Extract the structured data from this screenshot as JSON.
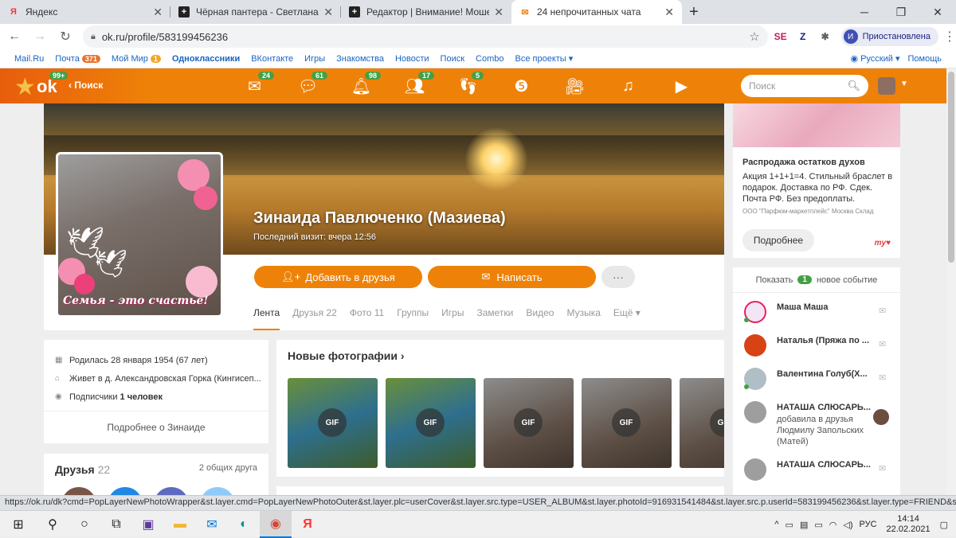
{
  "browser": {
    "tabs": [
      {
        "title": "Яндекс",
        "icon": "yandex-icon"
      },
      {
        "title": "Чёрная пантера - Светлана Хор",
        "icon": "bookmark-icon"
      },
      {
        "title": "Редактор | Внимание! Мошенн",
        "icon": "bookmark-icon"
      },
      {
        "title": "24 непрочитанных чата",
        "icon": "mail-icon"
      }
    ],
    "url": "ok.ru/profile/583199456236",
    "profile_label": "Приостановлена",
    "profile_initial": "И"
  },
  "portal": {
    "links": [
      {
        "label": "Mail.Ru",
        "badge": ""
      },
      {
        "label": "Почта",
        "badge": "371"
      },
      {
        "label": "Мой Мир",
        "badge": "1"
      },
      {
        "label": "Одноклассники",
        "badge": ""
      },
      {
        "label": "ВКонтакте",
        "badge": ""
      },
      {
        "label": "Игры",
        "badge": ""
      },
      {
        "label": "Знакомства",
        "badge": ""
      },
      {
        "label": "Новости",
        "badge": ""
      },
      {
        "label": "Поиск",
        "badge": ""
      },
      {
        "label": "Combo",
        "badge": ""
      },
      {
        "label": "Все проекты ▾",
        "badge": ""
      }
    ],
    "language": "Русский ▾",
    "help": "Помощь"
  },
  "okbar": {
    "logo_badge": "99+",
    "back_label": "Поиск",
    "nav": [
      {
        "icon": "messages-icon",
        "count": "24"
      },
      {
        "icon": "discussions-icon",
        "count": "61"
      },
      {
        "icon": "notifications-icon",
        "count": "98"
      },
      {
        "icon": "friends-icon",
        "count": "17"
      },
      {
        "icon": "guests-icon",
        "count": "5"
      },
      {
        "icon": "events-icon",
        "count": ""
      },
      {
        "icon": "video-icon",
        "count": ""
      },
      {
        "icon": "music-icon",
        "count": ""
      },
      {
        "icon": "games-icon",
        "count": ""
      }
    ],
    "search_placeholder": "Поиск"
  },
  "profile": {
    "name": "Зинаида Павлюченко (Мазиева)",
    "last_visit": "Последний визит: вчера 12:56",
    "avatar_caption": "Семья - это счастье!",
    "add_friend": "Добавить в друзья",
    "write": "Написать",
    "more": "···",
    "tabs": [
      "Лента",
      "Друзья 22",
      "Фото 11",
      "Группы",
      "Игры",
      "Заметки",
      "Видео",
      "Музыка",
      "Ещё ▾"
    ]
  },
  "info": {
    "born": "Родилась 28 января 1954 (67 лет)",
    "lives": "Живет в д. Александровская Горка (Кингисеп...",
    "subscribers_label": "Подписчики",
    "subscribers_value": "1 человек",
    "more_label": "Подробнее о Зинаиде"
  },
  "friends": {
    "title": "Друзья",
    "count": "22",
    "mutual": "2 общих друга"
  },
  "photos": {
    "title": "Новые фотографии ›",
    "gif_label": "GIF"
  },
  "ad": {
    "title": "Распродажа остатков духов",
    "text": "Акция 1+1+1=4. Стильный браслет в подарок. Доставка по РФ. Сдек. Почта РФ. Без предоплаты.",
    "source": "ООО \"Парфюм-маркетплейс\" Москва Склад",
    "button": "Подробнее",
    "logo": "my♥"
  },
  "feed": {
    "show_label": "Показать",
    "new_count": "1",
    "new_label": "новое событие",
    "items": [
      {
        "name": "Маша Маша",
        "sub": ""
      },
      {
        "name": "Наталья (Пряжа по ...",
        "sub": ""
      },
      {
        "name": "Валентина Голуб(Х...",
        "sub": ""
      },
      {
        "name": "НАТАША СЛЮСАРЬ...",
        "sub": "добавила в друзья Людмилу Запольских (Матей)"
      },
      {
        "name": "НАТАША СЛЮСАРЬ...",
        "sub": ""
      }
    ]
  },
  "statusbar": "https://ok.ru/dk?cmd=PopLayerNewPhotoWrapper&st.layer.cmd=PopLayerNewPhotoOuter&st.layer.plc=userCover&st.layer.src.type=USER_ALBUM&st.layer.photoId=916931541484&st.layer.src.p.userId=583199456236&st.layer.type=FRIEND&st.cm...",
  "taskbar": {
    "lang": "РУС",
    "time": "14:14",
    "date": "22.02.2021"
  },
  "colors": {
    "accent": "#ee8208",
    "badge": "#43a047",
    "link": "#1964c2"
  }
}
